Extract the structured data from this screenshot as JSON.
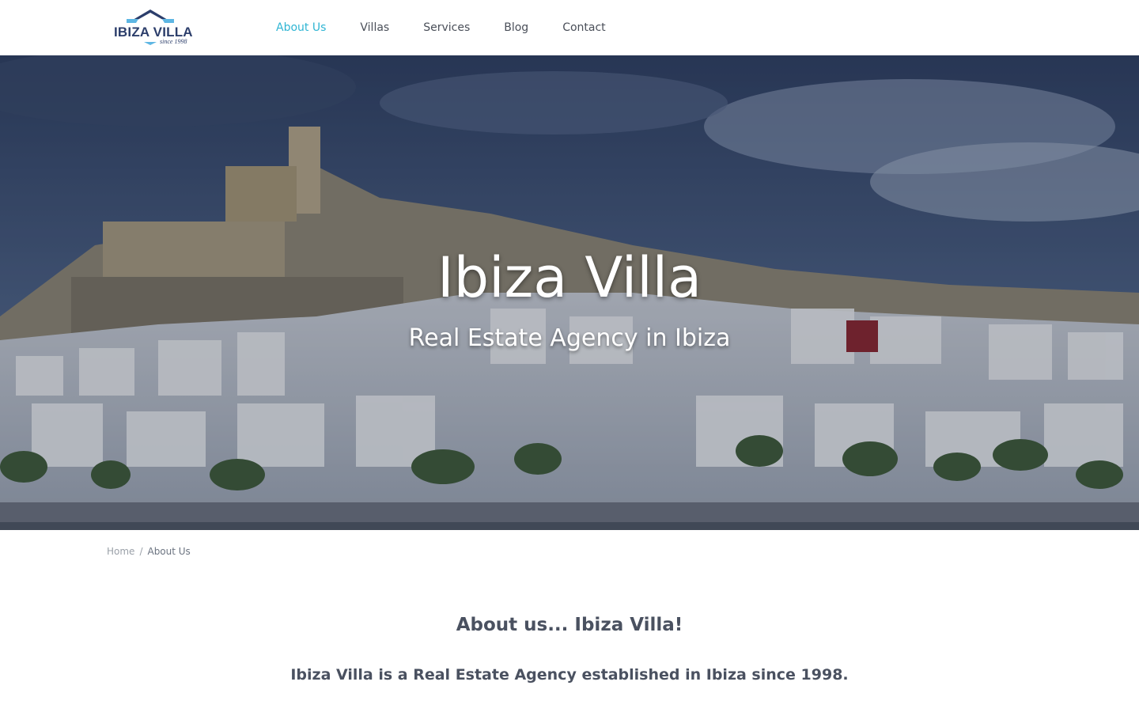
{
  "header": {
    "logo": {
      "text": "IBIZA VILLA",
      "tagline": "since 1998"
    },
    "nav": [
      {
        "label": "About Us",
        "active": true
      },
      {
        "label": "Villas",
        "active": false
      },
      {
        "label": "Services",
        "active": false
      },
      {
        "label": "Blog",
        "active": false
      },
      {
        "label": "Contact",
        "active": false
      }
    ]
  },
  "hero": {
    "title": "Ibiza Villa",
    "subtitle": "Real Estate Agency in Ibiza"
  },
  "breadcrumb": {
    "home": "Home",
    "separator": "/",
    "current": "About Us"
  },
  "content": {
    "title": "About us... Ibiza Villa!",
    "text": "Ibiza Villa is a Real Estate Agency established in Ibiza since 1998."
  },
  "colors": {
    "accent": "#2fb5d3",
    "logo": "#2c3e6b",
    "heading": "#4a5160"
  }
}
